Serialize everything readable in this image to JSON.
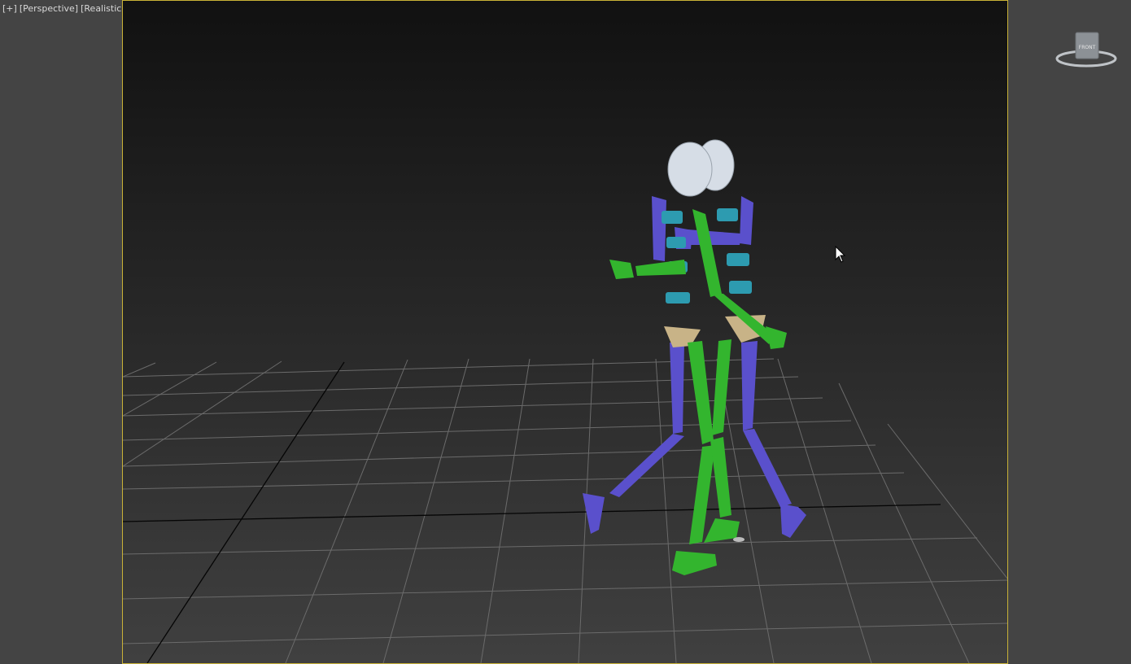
{
  "viewport": {
    "label_plus": "[+]",
    "label_view": "[Perspective]",
    "label_shading": "[Realistic]",
    "active_border_color": "#c9b237"
  },
  "viewcube": {
    "face_label": "FRONT",
    "icon": "viewcube-icon"
  },
  "scene": {
    "background_top": "#111111",
    "background_bottom": "#3a3a3a",
    "grid_color": "#6a6a6a",
    "axis_color": "#000000",
    "figures": [
      {
        "name": "biped-green",
        "color": "#33b52e"
      },
      {
        "name": "biped-blue",
        "color": "#5a50cc"
      }
    ],
    "spine_color": "#2d9bb0",
    "pelvis_color": "#c8b387",
    "head_color": "#d6dde6"
  }
}
